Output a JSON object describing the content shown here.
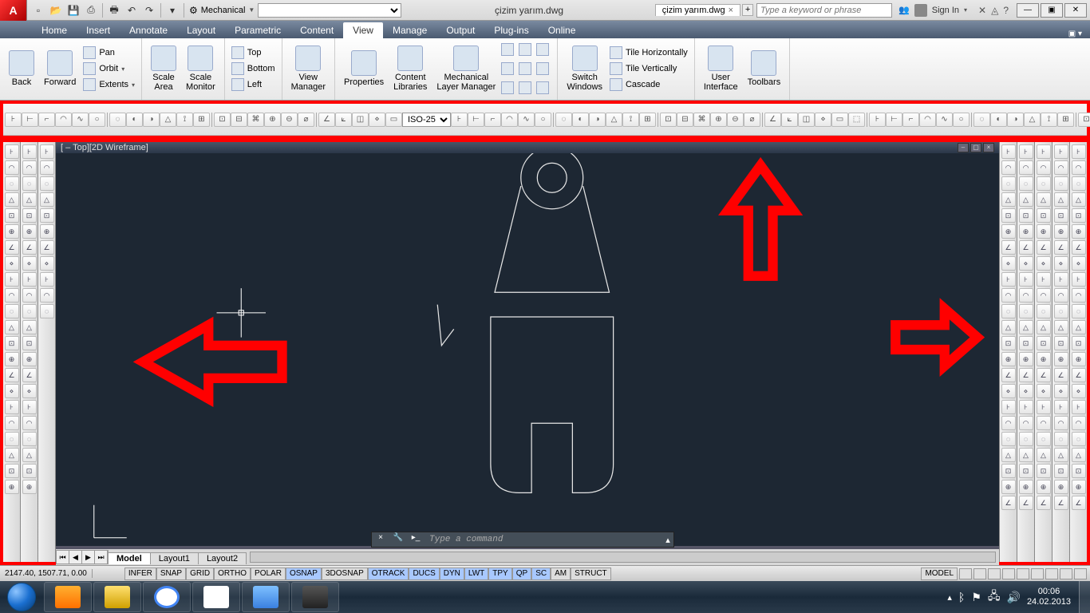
{
  "qat": {
    "workspace": "Mechanical",
    "doc_title": "çizim yarım.dwg",
    "tab_open": "çizim yarım.dwg",
    "search_ph": "Type a keyword or phrase",
    "signin": "Sign In"
  },
  "tabs": [
    "Home",
    "Insert",
    "Annotate",
    "Layout",
    "Parametric",
    "Content",
    "View",
    "Manage",
    "Output",
    "Plug-ins",
    "Online"
  ],
  "active_tab": "View",
  "ribbon": {
    "back": "Back",
    "forward": "Forward",
    "pan": "Pan",
    "orbit": "Orbit",
    "extents": "Extents",
    "scale_area": "Scale\nArea",
    "scale_monitor": "Scale\nMonitor",
    "top": "Top",
    "bottom": "Bottom",
    "left": "Left",
    "view_manager": "View\nManager",
    "properties": "Properties",
    "content_lib": "Content\nLibraries",
    "layer_mgr": "Mechanical\nLayer Manager",
    "switch": "Switch\nWindows",
    "tile_h": "Tile Horizontally",
    "tile_v": "Tile Vertically",
    "cascade": "Cascade",
    "ui": "User\nInterface",
    "toolbars": "Toolbars"
  },
  "dimstyle": "ISO-25",
  "viewport_title": "[ – Top][2D Wireframe]",
  "cmd_ph": "Type a command",
  "layouts": {
    "model": "Model",
    "l1": "Layout1",
    "l2": "Layout2"
  },
  "status": {
    "coords": "2147.40, 1507.71, 0.00",
    "toggles": [
      "INFER",
      "SNAP",
      "GRID",
      "ORTHO",
      "POLAR",
      "OSNAP",
      "3DOSNAP",
      "OTRACK",
      "DUCS",
      "DYN",
      "LWT",
      "TPY",
      "QP",
      "SC",
      "AM",
      "STRUCT"
    ],
    "on": [
      "OSNAP",
      "OTRACK",
      "DUCS",
      "DYN",
      "LWT",
      "TPY",
      "QP",
      "SC"
    ],
    "model": "MODEL"
  },
  "tray": {
    "time": "00:06",
    "date": "24.02.2013"
  }
}
